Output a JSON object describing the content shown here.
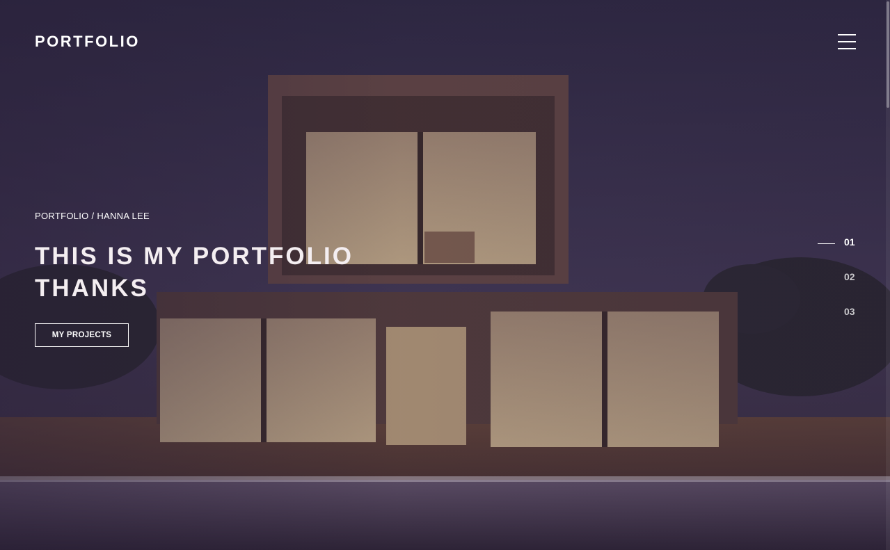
{
  "header": {
    "logo": "PORTFOLIO",
    "menu_icon": "hamburger-menu-icon"
  },
  "hero": {
    "breadcrumb": "PORTFOLIO / HANNA LEE",
    "headline_line1": "THIS IS MY PORTFOLIO",
    "headline_line2": "THANKS",
    "cta_label": "MY PROJECTS"
  },
  "slides": [
    {
      "label": "01",
      "active": true
    },
    {
      "label": "02",
      "active": false
    },
    {
      "label": "03",
      "active": false
    }
  ],
  "colors": {
    "overlay": "#2d2636",
    "text": "#ffffff"
  }
}
